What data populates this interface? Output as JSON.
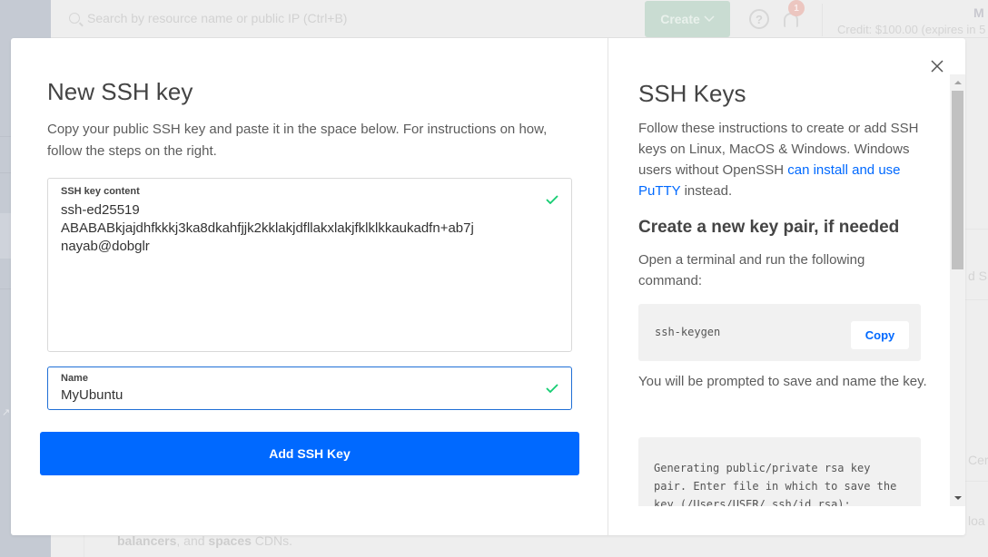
{
  "background": {
    "search_placeholder": "Search by resource name or public IP (Ctrl+B)",
    "create_label": "Create",
    "help_glyph": "?",
    "notification_count": "1",
    "user_initial": "M",
    "credit_text": "Credit: $100.00 (expires in 5",
    "footer_bold_1": "balancers",
    "footer_mid": ", and ",
    "footer_bold_2": "spaces",
    "footer_end": " CDNs.",
    "right_fragment_1": "d SS",
    "right_fragment_2": "Cert",
    "right_fragment_3": "loa",
    "sidebar_ext_icon": "↗"
  },
  "modal": {
    "title": "New SSH key",
    "description": "Copy your public SSH key and paste it in the space below. For instructions on how, follow the steps on the right.",
    "key_field": {
      "label": "SSH key content",
      "value": "ssh-ed25519\nABABABkjajdhfkkkj3ka8dkahfjjk2kklakjdfllakxlakjfklklkkaukadfn+ab7j\nnayab@dobglr",
      "valid": true
    },
    "name_field": {
      "label": "Name",
      "value": "MyUbuntu",
      "valid": true
    },
    "submit_label": "Add SSH Key",
    "colors": {
      "primary": "#0069ff",
      "valid": "#15cd72",
      "focus_border": "#1f6fd6"
    }
  },
  "help": {
    "title": "SSH Keys",
    "intro_text": "Follow these instructions to create or add SSH keys on Linux, MacOS & Windows. Windows users without OpenSSH ",
    "intro_link": "can install and use PuTTY",
    "intro_end": " instead.",
    "section_title": "Create a new key pair, if needed",
    "step1": "Open a terminal and run the following command:",
    "command": "ssh-keygen",
    "copy_label": "Copy",
    "step2": "You will be prompted to save and name the key.",
    "output_block": "Generating public/private rsa key pair. Enter file in which to save the key (/Users/USER/.ssh/id_rsa):"
  }
}
